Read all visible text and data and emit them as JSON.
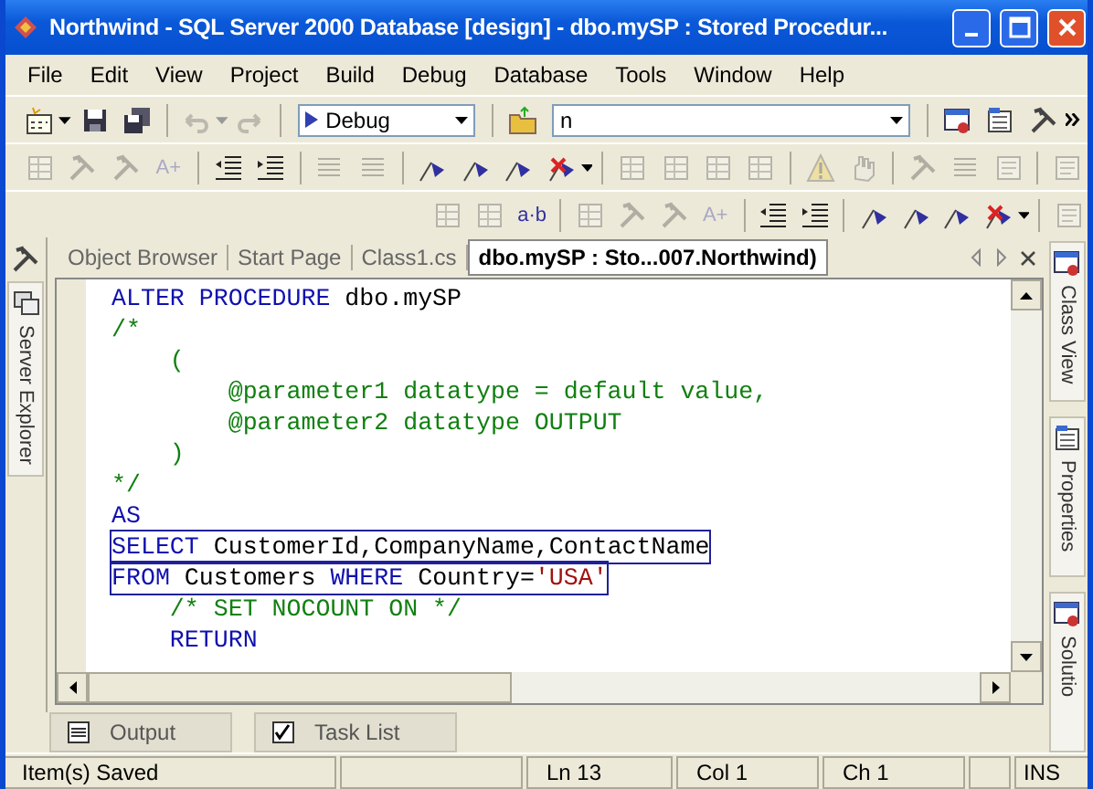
{
  "window": {
    "title": "Northwind - SQL Server 2000 Database [design] - dbo.mySP : Stored Procedur..."
  },
  "menu": [
    "File",
    "Edit",
    "View",
    "Project",
    "Build",
    "Debug",
    "Database",
    "Tools",
    "Window",
    "Help"
  ],
  "toolbar_1": {
    "items": [
      {
        "kind": "newproject",
        "disabled": false
      },
      {
        "kind": "save",
        "disabled": false
      },
      {
        "kind": "saveall",
        "disabled": false
      },
      {
        "kind": "separator"
      },
      {
        "kind": "undo",
        "disabled": true
      },
      {
        "kind": "redo",
        "disabled": true
      },
      {
        "kind": "separator"
      },
      {
        "kind": "config",
        "value": "Debug"
      },
      {
        "kind": "separator"
      },
      {
        "kind": "folder",
        "disabled": false
      },
      {
        "kind": "find",
        "value": "n"
      },
      {
        "kind": "separator"
      },
      {
        "kind": "window",
        "disabled": false
      },
      {
        "kind": "props",
        "disabled": false
      },
      {
        "kind": "tools",
        "disabled": false
      }
    ]
  },
  "toolbar_2": {
    "items": [
      {
        "kind": "grid",
        "disabled": true
      },
      {
        "kind": "tool",
        "disabled": true
      },
      {
        "kind": "tool",
        "disabled": true
      },
      {
        "kind": "text",
        "label": "A+",
        "disabled": true
      },
      {
        "kind": "separator"
      },
      {
        "kind": "outdent",
        "disabled": false
      },
      {
        "kind": "indent",
        "disabled": false
      },
      {
        "kind": "separator"
      },
      {
        "kind": "lines",
        "disabled": true
      },
      {
        "kind": "lines",
        "disabled": true
      },
      {
        "kind": "separator"
      },
      {
        "kind": "flag",
        "disabled": false
      },
      {
        "kind": "flag",
        "disabled": false
      },
      {
        "kind": "flag",
        "disabled": false
      },
      {
        "kind": "flagx",
        "disabled": false
      },
      {
        "kind": "separator"
      },
      {
        "kind": "grid",
        "disabled": true
      },
      {
        "kind": "grid",
        "disabled": true
      },
      {
        "kind": "grid",
        "disabled": true
      },
      {
        "kind": "grid",
        "disabled": true
      },
      {
        "kind": "separator"
      },
      {
        "kind": "bang",
        "disabled": true
      },
      {
        "kind": "hand",
        "disabled": true
      },
      {
        "kind": "separator"
      },
      {
        "kind": "tool",
        "disabled": true
      },
      {
        "kind": "lines",
        "disabled": true
      },
      {
        "kind": "doc",
        "disabled": true
      },
      {
        "kind": "separator"
      },
      {
        "kind": "doc",
        "disabled": true
      }
    ]
  },
  "toolbar_3": {
    "items": [
      {
        "kind": "grid",
        "disabled": true
      },
      {
        "kind": "grid",
        "disabled": true
      },
      {
        "kind": "text",
        "label": "a·b",
        "disabled": false
      },
      {
        "kind": "separator"
      },
      {
        "kind": "grid",
        "disabled": true
      },
      {
        "kind": "tool",
        "disabled": true
      },
      {
        "kind": "tool",
        "disabled": true
      },
      {
        "kind": "text",
        "label": "A+",
        "disabled": true
      },
      {
        "kind": "separator"
      },
      {
        "kind": "outdent",
        "disabled": false
      },
      {
        "kind": "indent",
        "disabled": false
      },
      {
        "kind": "separator"
      },
      {
        "kind": "flag",
        "disabled": false
      },
      {
        "kind": "flag",
        "disabled": false
      },
      {
        "kind": "flag",
        "disabled": false
      },
      {
        "kind": "flagx",
        "disabled": false
      },
      {
        "kind": "separator"
      },
      {
        "kind": "doc",
        "disabled": true
      }
    ]
  },
  "left_panel": {
    "label": "Server Explorer"
  },
  "right_panels": [
    {
      "label": "Class View"
    },
    {
      "label": "Properties"
    },
    {
      "label": "Solutio"
    }
  ],
  "document_tabs": [
    {
      "label": "Object Browser",
      "selected": false
    },
    {
      "label": "Start Page",
      "selected": false
    },
    {
      "label": "Class1.cs",
      "selected": false
    },
    {
      "label": "dbo.mySP : Sto...007.Northwind)",
      "selected": true
    }
  ],
  "code_lines": [
    {
      "selected": false,
      "tokens": [
        {
          "kind": "keyword",
          "text": "ALTER PROCEDURE"
        },
        {
          "kind": "plain",
          "text": " dbo.mySP"
        }
      ]
    },
    {
      "selected": false,
      "tokens": [
        {
          "kind": "comment",
          "text": "/*"
        }
      ]
    },
    {
      "selected": false,
      "tokens": [
        {
          "kind": "comment",
          "text": "    ("
        }
      ]
    },
    {
      "selected": false,
      "tokens": [
        {
          "kind": "comment",
          "text": "        @parameter1 datatype = default value,"
        }
      ]
    },
    {
      "selected": false,
      "tokens": [
        {
          "kind": "comment",
          "text": "        @parameter2 datatype OUTPUT"
        }
      ]
    },
    {
      "selected": false,
      "tokens": [
        {
          "kind": "comment",
          "text": "    )"
        }
      ]
    },
    {
      "selected": false,
      "tokens": [
        {
          "kind": "comment",
          "text": "*/"
        }
      ]
    },
    {
      "selected": false,
      "tokens": [
        {
          "kind": "keyword",
          "text": "AS"
        }
      ]
    },
    {
      "selected": true,
      "tokens": [
        {
          "kind": "keyword",
          "text": "SELECT"
        },
        {
          "kind": "plain",
          "text": " CustomerId,CompanyName,ContactName"
        }
      ]
    },
    {
      "selected": true,
      "tokens": [
        {
          "kind": "keyword",
          "text": "FROM"
        },
        {
          "kind": "plain",
          "text": " Customers "
        },
        {
          "kind": "keyword",
          "text": "WHERE"
        },
        {
          "kind": "plain",
          "text": " Country="
        },
        {
          "kind": "string",
          "text": "'USA'"
        }
      ]
    },
    {
      "selected": false,
      "tokens": [
        {
          "kind": "comment",
          "text": "    /* SET NOCOUNT ON */"
        }
      ]
    },
    {
      "selected": false,
      "tokens": [
        {
          "kind": "keyword",
          "text": "    RETURN"
        }
      ]
    }
  ],
  "bottom_tabs": [
    {
      "label": "Output",
      "kind": "output"
    },
    {
      "label": "Task List",
      "kind": "tasks"
    }
  ],
  "status_bar": {
    "message": "Item(s) Saved",
    "line": "Ln 13",
    "column": "Col 1",
    "char": "Ch 1",
    "mode": "INS"
  }
}
